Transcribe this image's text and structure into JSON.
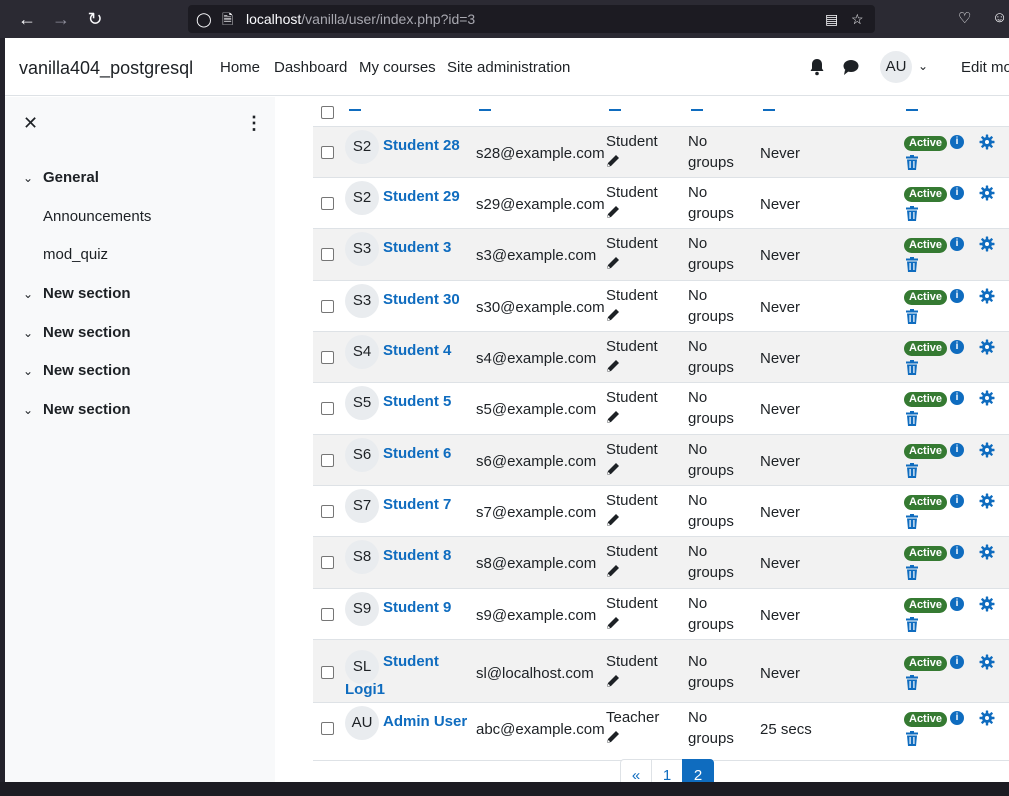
{
  "browser": {
    "url_host": "localhost",
    "url_path": "/vanilla/user/index.php?id=3"
  },
  "site": {
    "name": "vanilla404_postgresql",
    "nav": [
      "Home",
      "Dashboard",
      "My courses",
      "Site administration"
    ],
    "user_initials": "AU",
    "edit_mode_label": "Edit mo"
  },
  "drawer": {
    "sections": [
      {
        "label": "General",
        "items": [
          "Announcements",
          "mod_quiz"
        ]
      },
      {
        "label": "New section",
        "items": []
      },
      {
        "label": "New section",
        "items": []
      },
      {
        "label": "New section",
        "items": []
      },
      {
        "label": "New section",
        "items": []
      }
    ]
  },
  "participants": [
    {
      "initials": "S2",
      "name": "Student 28",
      "email": "s28@example.com",
      "role": "Student",
      "groups": "No groups",
      "last_access": "Never",
      "status": "Active"
    },
    {
      "initials": "S2",
      "name": "Student 29",
      "email": "s29@example.com",
      "role": "Student",
      "groups": "No groups",
      "last_access": "Never",
      "status": "Active"
    },
    {
      "initials": "S3",
      "name": "Student 3",
      "email": "s3@example.com",
      "role": "Student",
      "groups": "No groups",
      "last_access": "Never",
      "status": "Active"
    },
    {
      "initials": "S3",
      "name": "Student 30",
      "email": "s30@example.com",
      "role": "Student",
      "groups": "No groups",
      "last_access": "Never",
      "status": "Active"
    },
    {
      "initials": "S4",
      "name": "Student 4",
      "email": "s4@example.com",
      "role": "Student",
      "groups": "No groups",
      "last_access": "Never",
      "status": "Active"
    },
    {
      "initials": "S5",
      "name": "Student 5",
      "email": "s5@example.com",
      "role": "Student",
      "groups": "No groups",
      "last_access": "Never",
      "status": "Active"
    },
    {
      "initials": "S6",
      "name": "Student 6",
      "email": "s6@example.com",
      "role": "Student",
      "groups": "No groups",
      "last_access": "Never",
      "status": "Active"
    },
    {
      "initials": "S7",
      "name": "Student 7",
      "email": "s7@example.com",
      "role": "Student",
      "groups": "No groups",
      "last_access": "Never",
      "status": "Active"
    },
    {
      "initials": "S8",
      "name": "Student 8",
      "email": "s8@example.com",
      "role": "Student",
      "groups": "No groups",
      "last_access": "Never",
      "status": "Active"
    },
    {
      "initials": "S9",
      "name": "Student 9",
      "email": "s9@example.com",
      "role": "Student",
      "groups": "No groups",
      "last_access": "Never",
      "status": "Active"
    },
    {
      "initials": "SL",
      "name_line1": "Student",
      "name_line2": "Logi1",
      "email": "sl@localhost.com",
      "role": "Student",
      "groups": "No groups",
      "last_access": "Never",
      "status": "Active"
    },
    {
      "initials": "AU",
      "name": "Admin User",
      "email": "abc@example.com",
      "role": "Teacher",
      "groups": "No groups",
      "last_access": "25 secs",
      "status": "Active"
    }
  ],
  "pagination": {
    "prev": "«",
    "pages": [
      "1",
      "2"
    ],
    "current": "2"
  },
  "colors": {
    "accent": "#0f6cbf",
    "active_badge": "#357a32"
  }
}
